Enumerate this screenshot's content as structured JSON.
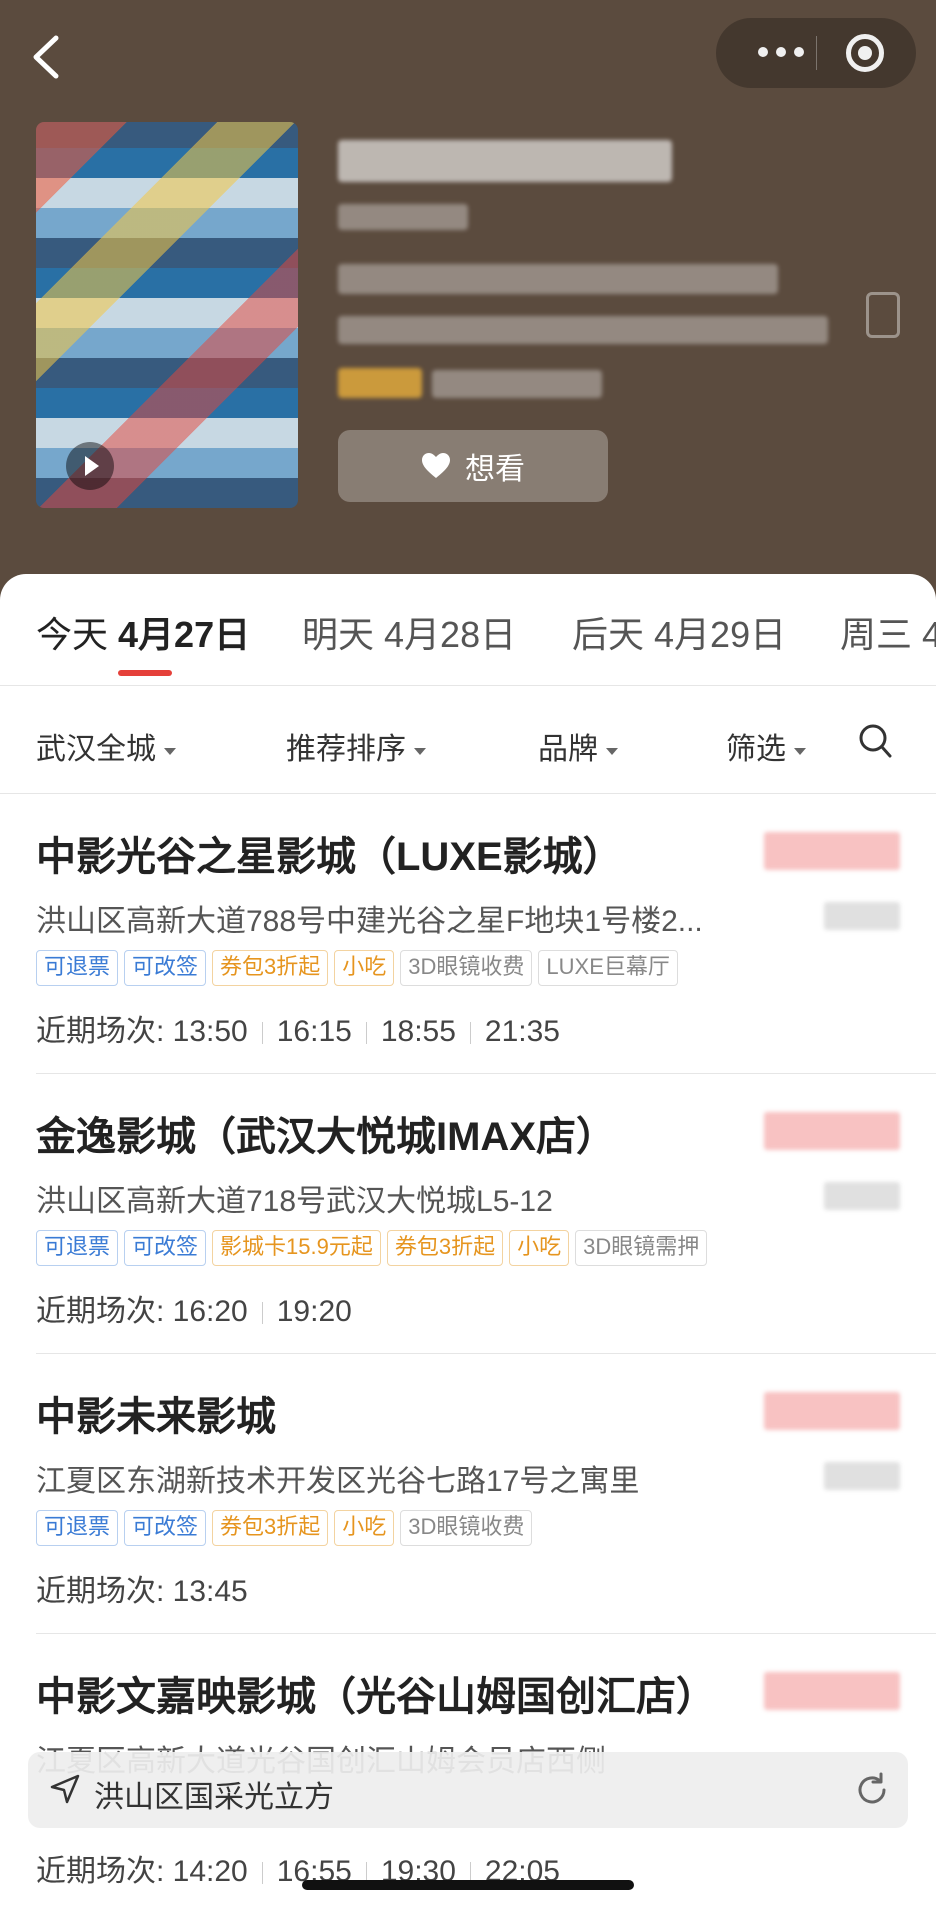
{
  "header": {
    "want_label": "想看",
    "colors": {
      "background": "#5b4b3e"
    }
  },
  "date_tabs": [
    {
      "weekday": "今天",
      "date": "4月27日",
      "active": true
    },
    {
      "weekday": "明天",
      "date": "4月28日",
      "active": false
    },
    {
      "weekday": "后天",
      "date": "4月29日",
      "active": false
    },
    {
      "weekday": "周三",
      "date": "4",
      "active": false
    }
  ],
  "filters": {
    "city": "武汉全城",
    "sort": "推荐排序",
    "brand": "品牌",
    "filter": "筛选"
  },
  "cinemas": [
    {
      "name": "中影光谷之星影城（LUXE影城）",
      "address": "洪山区高新大道788号中建光谷之星F地块1号楼2...",
      "tags": [
        {
          "text": "可退票",
          "style": "blue"
        },
        {
          "text": "可改签",
          "style": "blue"
        },
        {
          "text": "券包3折起",
          "style": "orange"
        },
        {
          "text": "小吃",
          "style": "orange"
        },
        {
          "text": "3D眼镜收费",
          "style": "gray"
        },
        {
          "text": "LUXE巨幕厅",
          "style": "gray"
        }
      ],
      "sessions_label": "近期场次: ",
      "sessions": [
        "13:50",
        "16:15",
        "18:55",
        "21:35"
      ]
    },
    {
      "name": "金逸影城（武汉大悦城IMAX店）",
      "address": "洪山区高新大道718号武汉大悦城L5-12",
      "tags": [
        {
          "text": "可退票",
          "style": "blue"
        },
        {
          "text": "可改签",
          "style": "blue"
        },
        {
          "text": "影城卡15.9元起",
          "style": "orange"
        },
        {
          "text": "券包3折起",
          "style": "orange"
        },
        {
          "text": "小吃",
          "style": "orange"
        },
        {
          "text": "3D眼镜需押",
          "style": "gray"
        }
      ],
      "sessions_label": "近期场次: ",
      "sessions": [
        "16:20",
        "19:20"
      ]
    },
    {
      "name": "中影未来影城",
      "address": "江夏区东湖新技术开发区光谷七路17号之寓里",
      "tags": [
        {
          "text": "可退票",
          "style": "blue"
        },
        {
          "text": "可改签",
          "style": "blue"
        },
        {
          "text": "券包3折起",
          "style": "orange"
        },
        {
          "text": "小吃",
          "style": "orange"
        },
        {
          "text": "3D眼镜收费",
          "style": "gray"
        }
      ],
      "sessions_label": "近期场次: ",
      "sessions": [
        "13:45"
      ]
    },
    {
      "name": "中影文嘉映影城（光谷山姆国创汇店）",
      "address": "江夏区高新大道光谷国创汇山姆会员店西侧",
      "tags": [],
      "sessions_label": "近期场次: ",
      "sessions": [
        "14:20",
        "16:55",
        "19:30",
        "22:05"
      ]
    }
  ],
  "location_bar": {
    "text": "洪山区国采光立方"
  },
  "icons": [
    "back-icon",
    "more-icon",
    "target-icon",
    "heart-icon",
    "search-icon",
    "location-arrow-icon",
    "refresh-icon",
    "play-icon"
  ]
}
